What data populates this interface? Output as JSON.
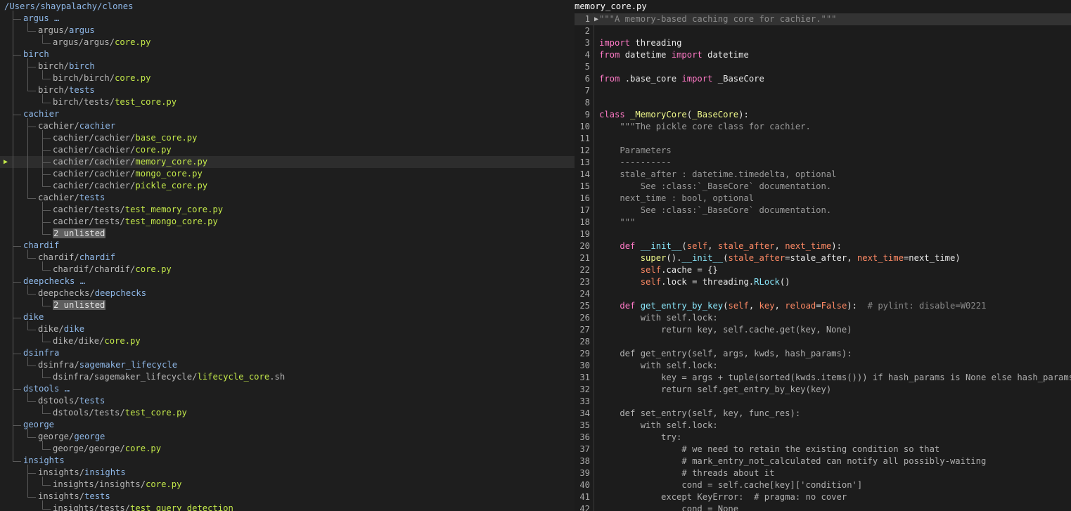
{
  "tree": {
    "root": "/Users/shaypalachy/clones",
    "rows": [
      {
        "indent": 1,
        "parts": [
          [
            "dir",
            "argus …"
          ]
        ]
      },
      {
        "indent": 2,
        "parts": [
          [
            "pre",
            "argus/"
          ],
          [
            "dir",
            "argus"
          ]
        ]
      },
      {
        "indent": 3,
        "parts": [
          [
            "pre",
            "argus/argus/"
          ],
          [
            "file",
            "core.py"
          ]
        ]
      },
      {
        "indent": 1,
        "parts": [
          [
            "dir",
            "birch"
          ]
        ]
      },
      {
        "indent": 2,
        "parts": [
          [
            "pre",
            "birch/"
          ],
          [
            "dir",
            "birch"
          ]
        ]
      },
      {
        "indent": 3,
        "parts": [
          [
            "pre",
            "birch/birch/"
          ],
          [
            "file",
            "core.py"
          ]
        ]
      },
      {
        "indent": 2,
        "parts": [
          [
            "pre",
            "birch/"
          ],
          [
            "dir",
            "tests"
          ]
        ]
      },
      {
        "indent": 3,
        "parts": [
          [
            "pre",
            "birch/tests/"
          ],
          [
            "file",
            "test_core.py"
          ]
        ]
      },
      {
        "indent": 1,
        "parts": [
          [
            "dir",
            "cachier"
          ]
        ]
      },
      {
        "indent": 2,
        "parts": [
          [
            "pre",
            "cachier/"
          ],
          [
            "dir",
            "cachier"
          ]
        ]
      },
      {
        "indent": 3,
        "parts": [
          [
            "pre",
            "cachier/cachier/"
          ],
          [
            "file",
            "base_core.py"
          ]
        ]
      },
      {
        "indent": 3,
        "parts": [
          [
            "pre",
            "cachier/cachier/"
          ],
          [
            "file",
            "core.py"
          ]
        ]
      },
      {
        "indent": 3,
        "parts": [
          [
            "pre",
            "cachier/cachier/"
          ],
          [
            "file",
            "memory_core.py"
          ]
        ],
        "selected": true
      },
      {
        "indent": 3,
        "parts": [
          [
            "pre",
            "cachier/cachier/"
          ],
          [
            "file",
            "mongo_core.py"
          ]
        ]
      },
      {
        "indent": 3,
        "parts": [
          [
            "pre",
            "cachier/cachier/"
          ],
          [
            "file",
            "pickle_core.py"
          ]
        ]
      },
      {
        "indent": 2,
        "parts": [
          [
            "pre",
            "cachier/"
          ],
          [
            "dir",
            "tests"
          ]
        ]
      },
      {
        "indent": 3,
        "parts": [
          [
            "pre",
            "cachier/tests/"
          ],
          [
            "file",
            "test_memory_core.py"
          ]
        ]
      },
      {
        "indent": 3,
        "parts": [
          [
            "pre",
            "cachier/tests/"
          ],
          [
            "file",
            "test_mongo_core.py"
          ]
        ]
      },
      {
        "indent": 3,
        "parts": [
          [
            "unl",
            "2 unlisted"
          ]
        ]
      },
      {
        "indent": 1,
        "parts": [
          [
            "dir",
            "chardif"
          ]
        ]
      },
      {
        "indent": 2,
        "parts": [
          [
            "pre",
            "chardif/"
          ],
          [
            "dir",
            "chardif"
          ]
        ]
      },
      {
        "indent": 3,
        "parts": [
          [
            "pre",
            "chardif/chardif/"
          ],
          [
            "file",
            "core.py"
          ]
        ]
      },
      {
        "indent": 1,
        "parts": [
          [
            "dir",
            "deepchecks …"
          ]
        ]
      },
      {
        "indent": 2,
        "parts": [
          [
            "pre",
            "deepchecks/"
          ],
          [
            "dir",
            "deepchecks"
          ]
        ]
      },
      {
        "indent": 3,
        "parts": [
          [
            "unl",
            "2 unlisted"
          ]
        ]
      },
      {
        "indent": 1,
        "parts": [
          [
            "dir",
            "dike"
          ]
        ]
      },
      {
        "indent": 2,
        "parts": [
          [
            "pre",
            "dike/"
          ],
          [
            "dir",
            "dike"
          ]
        ]
      },
      {
        "indent": 3,
        "parts": [
          [
            "pre",
            "dike/dike/"
          ],
          [
            "file",
            "core.py"
          ]
        ]
      },
      {
        "indent": 1,
        "parts": [
          [
            "dir",
            "dsinfra"
          ]
        ]
      },
      {
        "indent": 2,
        "parts": [
          [
            "pre",
            "dsinfra/"
          ],
          [
            "dir",
            "sagemaker_lifecycle"
          ]
        ]
      },
      {
        "indent": 3,
        "parts": [
          [
            "pre",
            "dsinfra/sagemaker_lifecycle/"
          ],
          [
            "file",
            "lifecycle_core"
          ],
          [
            "pre",
            ".sh"
          ]
        ]
      },
      {
        "indent": 1,
        "parts": [
          [
            "dir",
            "dstools …"
          ]
        ]
      },
      {
        "indent": 2,
        "parts": [
          [
            "pre",
            "dstools/"
          ],
          [
            "dir",
            "tests"
          ]
        ]
      },
      {
        "indent": 3,
        "parts": [
          [
            "pre",
            "dstools/tests/"
          ],
          [
            "file",
            "test_core.py"
          ]
        ]
      },
      {
        "indent": 1,
        "parts": [
          [
            "dir",
            "george"
          ]
        ]
      },
      {
        "indent": 2,
        "parts": [
          [
            "pre",
            "george/"
          ],
          [
            "dir",
            "george"
          ]
        ]
      },
      {
        "indent": 3,
        "parts": [
          [
            "pre",
            "george/george/"
          ],
          [
            "file",
            "core.py"
          ]
        ]
      },
      {
        "indent": 1,
        "parts": [
          [
            "dir",
            "insights"
          ]
        ]
      },
      {
        "indent": 2,
        "parts": [
          [
            "pre",
            "insights/"
          ],
          [
            "dir",
            "insights"
          ]
        ]
      },
      {
        "indent": 3,
        "parts": [
          [
            "pre",
            "insights/insights/"
          ],
          [
            "file",
            "core.py"
          ]
        ]
      },
      {
        "indent": 2,
        "parts": [
          [
            "pre",
            "insights/"
          ],
          [
            "dir",
            "tests"
          ]
        ]
      },
      {
        "indent": 3,
        "parts": [
          [
            "pre",
            "insights/tests/"
          ],
          [
            "file",
            "test_query_detection"
          ]
        ]
      }
    ]
  },
  "editor": {
    "filename": "memory_core.py",
    "current_line": 1,
    "lines": [
      [
        [
          "str",
          "\"\"\"A memory-based caching core for cachier.\"\"\""
        ]
      ],
      [],
      [
        [
          "kw",
          "import"
        ],
        [
          "plain",
          " threading"
        ]
      ],
      [
        [
          "kw",
          "from"
        ],
        [
          "plain",
          " datetime "
        ],
        [
          "kw",
          "import"
        ],
        [
          "plain",
          " datetime"
        ]
      ],
      [],
      [
        [
          "kw",
          "from"
        ],
        [
          "plain",
          " .base_core "
        ],
        [
          "kw",
          "import"
        ],
        [
          "plain",
          " _BaseCore"
        ]
      ],
      [],
      [],
      [
        [
          "kw",
          "class"
        ],
        [
          "plain",
          " "
        ],
        [
          "cls",
          "_MemoryCore"
        ],
        [
          "plain",
          "("
        ],
        [
          "cls",
          "_BaseCore"
        ],
        [
          "plain",
          "):"
        ]
      ],
      [
        [
          "ds",
          "    \"\"\"The pickle core class for cachier."
        ]
      ],
      [],
      [
        [
          "ds",
          "    Parameters"
        ]
      ],
      [
        [
          "ds",
          "    ----------"
        ]
      ],
      [
        [
          "ds",
          "    stale_after : datetime.timedelta, optional"
        ]
      ],
      [
        [
          "ds",
          "        See :class:`_BaseCore` documentation."
        ]
      ],
      [
        [
          "ds",
          "    next_time : bool, optional"
        ]
      ],
      [
        [
          "ds",
          "        See :class:`_BaseCore` documentation."
        ]
      ],
      [
        [
          "ds",
          "    \"\"\""
        ]
      ],
      [],
      [
        [
          "plain",
          "    "
        ],
        [
          "kw",
          "def"
        ],
        [
          "plain",
          " "
        ],
        [
          "fn",
          "__init__"
        ],
        [
          "plain",
          "("
        ],
        [
          "prm",
          "self"
        ],
        [
          "plain",
          ", "
        ],
        [
          "prm",
          "stale_after"
        ],
        [
          "plain",
          ", "
        ],
        [
          "prm",
          "next_time"
        ],
        [
          "plain",
          "):"
        ]
      ],
      [
        [
          "plain",
          "        "
        ],
        [
          "kw2",
          "super"
        ],
        [
          "plain",
          "()."
        ],
        [
          "fn",
          "__init__"
        ],
        [
          "plain",
          "("
        ],
        [
          "prm",
          "stale_after"
        ],
        [
          "plain",
          "=stale_after, "
        ],
        [
          "prm",
          "next_time"
        ],
        [
          "plain",
          "=next_time)"
        ]
      ],
      [
        [
          "plain",
          "        "
        ],
        [
          "prm",
          "self"
        ],
        [
          "plain",
          ".cache = {}"
        ]
      ],
      [
        [
          "plain",
          "        "
        ],
        [
          "prm",
          "self"
        ],
        [
          "plain",
          ".lock = threading."
        ],
        [
          "fn",
          "RLock"
        ],
        [
          "plain",
          "()"
        ]
      ],
      [],
      [
        [
          "plain",
          "    "
        ],
        [
          "kw",
          "def"
        ],
        [
          "plain",
          " "
        ],
        [
          "fn",
          "get_entry_by_key"
        ],
        [
          "plain",
          "("
        ],
        [
          "prm",
          "self"
        ],
        [
          "plain",
          ", "
        ],
        [
          "prm",
          "key"
        ],
        [
          "plain",
          ", "
        ],
        [
          "prm",
          "reload"
        ],
        [
          "plain",
          "="
        ],
        [
          "bool",
          "False"
        ],
        [
          "plain",
          "):  "
        ],
        [
          "cmt",
          "# pylint: disable=W0221"
        ]
      ],
      [
        [
          "dim",
          "        with self.lock:"
        ]
      ],
      [
        [
          "dim",
          "            return key, self.cache.get(key, None)"
        ]
      ],
      [],
      [
        [
          "dim",
          "    def get_entry(self, args, kwds, hash_params):"
        ]
      ],
      [
        [
          "dim",
          "        with self.lock:"
        ]
      ],
      [
        [
          "dim",
          "            key = args + tuple(sorted(kwds.items())) if hash_params is None else hash_params(args"
        ]
      ],
      [
        [
          "dim",
          "            return self.get_entry_by_key(key)"
        ]
      ],
      [],
      [
        [
          "dim",
          "    def set_entry(self, key, func_res):"
        ]
      ],
      [
        [
          "dim",
          "        with self.lock:"
        ]
      ],
      [
        [
          "dim",
          "            try:"
        ]
      ],
      [
        [
          "dim",
          "                # we need to retain the existing condition so that"
        ]
      ],
      [
        [
          "dim",
          "                # mark_entry_not_calculated can notify all possibly-waiting"
        ]
      ],
      [
        [
          "dim",
          "                # threads about it"
        ]
      ],
      [
        [
          "dim",
          "                cond = self.cache[key]['condition']"
        ]
      ],
      [
        [
          "dim",
          "            except KeyError:  # pragma: no cover"
        ]
      ],
      [
        [
          "dim",
          "                cond = None"
        ]
      ]
    ]
  }
}
